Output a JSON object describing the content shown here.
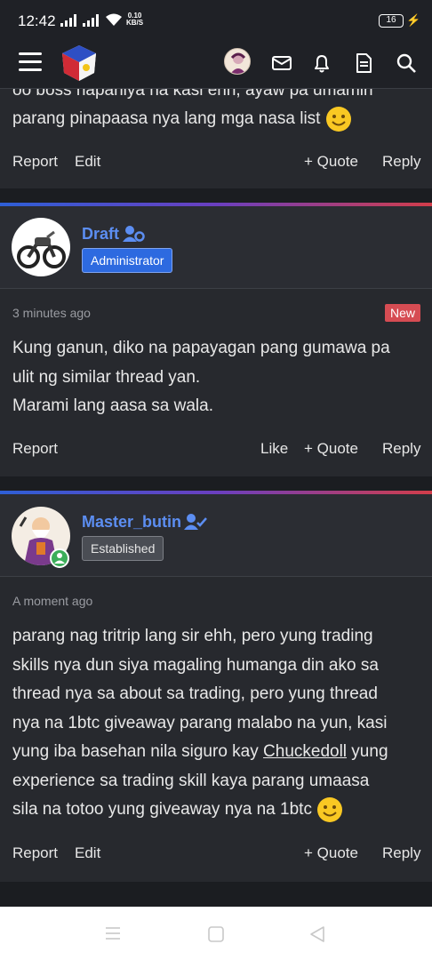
{
  "status_bar": {
    "time": "12:42",
    "net_speed_value": "0.10",
    "net_speed_unit": "KB/S",
    "battery": "16"
  },
  "colors": {
    "accent": "#5c8ef2",
    "admin_badge": "#2d6ae0",
    "new_badge": "#d64c53",
    "background": "#27292e"
  },
  "header": {
    "icons": [
      "menu-icon",
      "site-logo",
      "user-avatar",
      "mail-icon",
      "bell-icon",
      "document-icon",
      "search-icon"
    ]
  },
  "posts": [
    {
      "body_lines": [
        "oo boss napaniya na kasi ehh, ayaw pa umamin",
        "parang pinapaasa nya lang mga nasa list"
      ],
      "actions": {
        "report": "Report",
        "edit": "Edit",
        "quote": "+ Quote",
        "reply": "Reply"
      }
    },
    {
      "username": "Draft",
      "role": "Administrator",
      "timestamp": "3 minutes ago",
      "new_label": "New",
      "body_lines": [
        "Kung ganun, diko na papayagan pang gumawa pa",
        "ulit ng similar thread yan.",
        "Marami lang aasa sa wala."
      ],
      "actions": {
        "report": "Report",
        "like": "Like",
        "quote": "+ Quote",
        "reply": "Reply"
      }
    },
    {
      "username": "Master_butin",
      "role": "Established",
      "timestamp": "A moment ago",
      "body_lines": [
        "parang nag tritrip lang sir ehh, pero yung trading",
        "skills nya dun siya magaling humanga din ako sa",
        "thread nya sa about sa trading, pero yung thread",
        "nya na 1btc giveaway parang malabo na yun, kasi",
        "yung iba basehan nila siguro kay ",
        "Chuckedoll",
        " yung",
        "experience sa trading skill kaya parang umaasa",
        "sila na totoo yung giveaway nya na 1btc"
      ],
      "actions": {
        "report": "Report",
        "edit": "Edit",
        "quote": "+ Quote",
        "reply": "Reply"
      }
    }
  ]
}
